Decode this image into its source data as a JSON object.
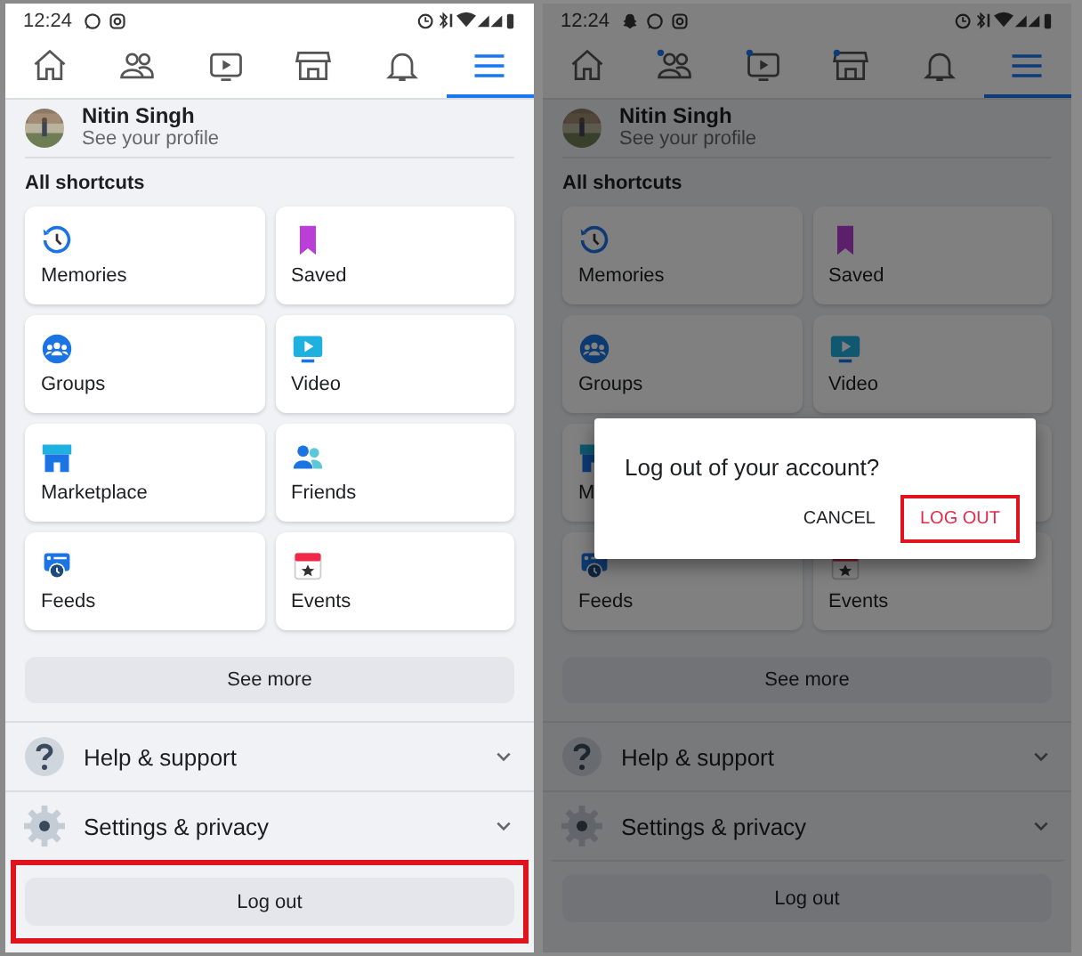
{
  "panels": [
    {
      "status_bar": {
        "time": "12:24",
        "apps": [
          {
            "kind": "whatsapp"
          },
          {
            "kind": "instagram"
          }
        ]
      },
      "tabs": [
        {
          "kind": "home",
          "selected": false,
          "badge": false
        },
        {
          "kind": "friends",
          "selected": false,
          "badge": false
        },
        {
          "kind": "video",
          "selected": false,
          "badge": false
        },
        {
          "kind": "marketplace",
          "selected": false,
          "badge": false
        },
        {
          "kind": "bell",
          "selected": false,
          "badge": false
        },
        {
          "kind": "menu",
          "selected": true,
          "badge": false
        }
      ],
      "profile": {
        "name": "Nitin Singh",
        "subtitle": "See your profile"
      },
      "section_title": "All shortcuts",
      "shortcuts": [
        {
          "kind": "memories",
          "label": "Memories"
        },
        {
          "kind": "saved",
          "label": "Saved"
        },
        {
          "kind": "groups",
          "label": "Groups"
        },
        {
          "kind": "video",
          "label": "Video"
        },
        {
          "kind": "marketplace",
          "label": "Marketplace"
        },
        {
          "kind": "friends",
          "label": "Friends"
        },
        {
          "kind": "feeds",
          "label": "Feeds"
        },
        {
          "kind": "events",
          "label": "Events"
        }
      ],
      "see_more": "See more",
      "menu": [
        {
          "kind": "help",
          "label": "Help & support",
          "expanded": false
        },
        {
          "kind": "settings",
          "label": "Settings & privacy",
          "expanded": false
        }
      ],
      "logout": {
        "label": "Log out",
        "highlighted": true
      },
      "dimmed": false
    },
    {
      "status_bar": {
        "time": "12:24",
        "apps": [
          {
            "kind": "snapchat"
          },
          {
            "kind": "whatsapp"
          },
          {
            "kind": "instagram"
          }
        ]
      },
      "tabs": [
        {
          "kind": "home",
          "selected": false,
          "badge": false
        },
        {
          "kind": "friends",
          "selected": false,
          "badge": true
        },
        {
          "kind": "video",
          "selected": false,
          "badge": true
        },
        {
          "kind": "marketplace",
          "selected": false,
          "badge": true
        },
        {
          "kind": "bell",
          "selected": false,
          "badge": false
        },
        {
          "kind": "menu",
          "selected": true,
          "badge": false
        }
      ],
      "profile": {
        "name": "Nitin Singh",
        "subtitle": "See your profile"
      },
      "section_title": "All shortcuts",
      "shortcuts": [
        {
          "kind": "memories",
          "label": "Memories"
        },
        {
          "kind": "saved",
          "label": "Saved"
        },
        {
          "kind": "groups",
          "label": "Groups"
        },
        {
          "kind": "video",
          "label": "Video"
        },
        {
          "kind": "marketplace",
          "label": "M"
        },
        {
          "kind": "blank"
        },
        {
          "kind": "feeds",
          "label": "Feeds"
        },
        {
          "kind": "events",
          "label": "Events"
        }
      ],
      "see_more": "See more",
      "menu": [
        {
          "kind": "help",
          "label": "Help & support",
          "expanded": false
        },
        {
          "kind": "settings",
          "label": "Settings & privacy",
          "expanded": false
        }
      ],
      "logout": {
        "label": "Log out",
        "highlighted": false
      },
      "dimmed": true,
      "dialog": {
        "message": "Log out of your account?",
        "buttons": [
          {
            "label": "CANCEL",
            "highlighted": false
          },
          {
            "label": "LOG OUT",
            "highlighted": true
          }
        ]
      }
    }
  ]
}
